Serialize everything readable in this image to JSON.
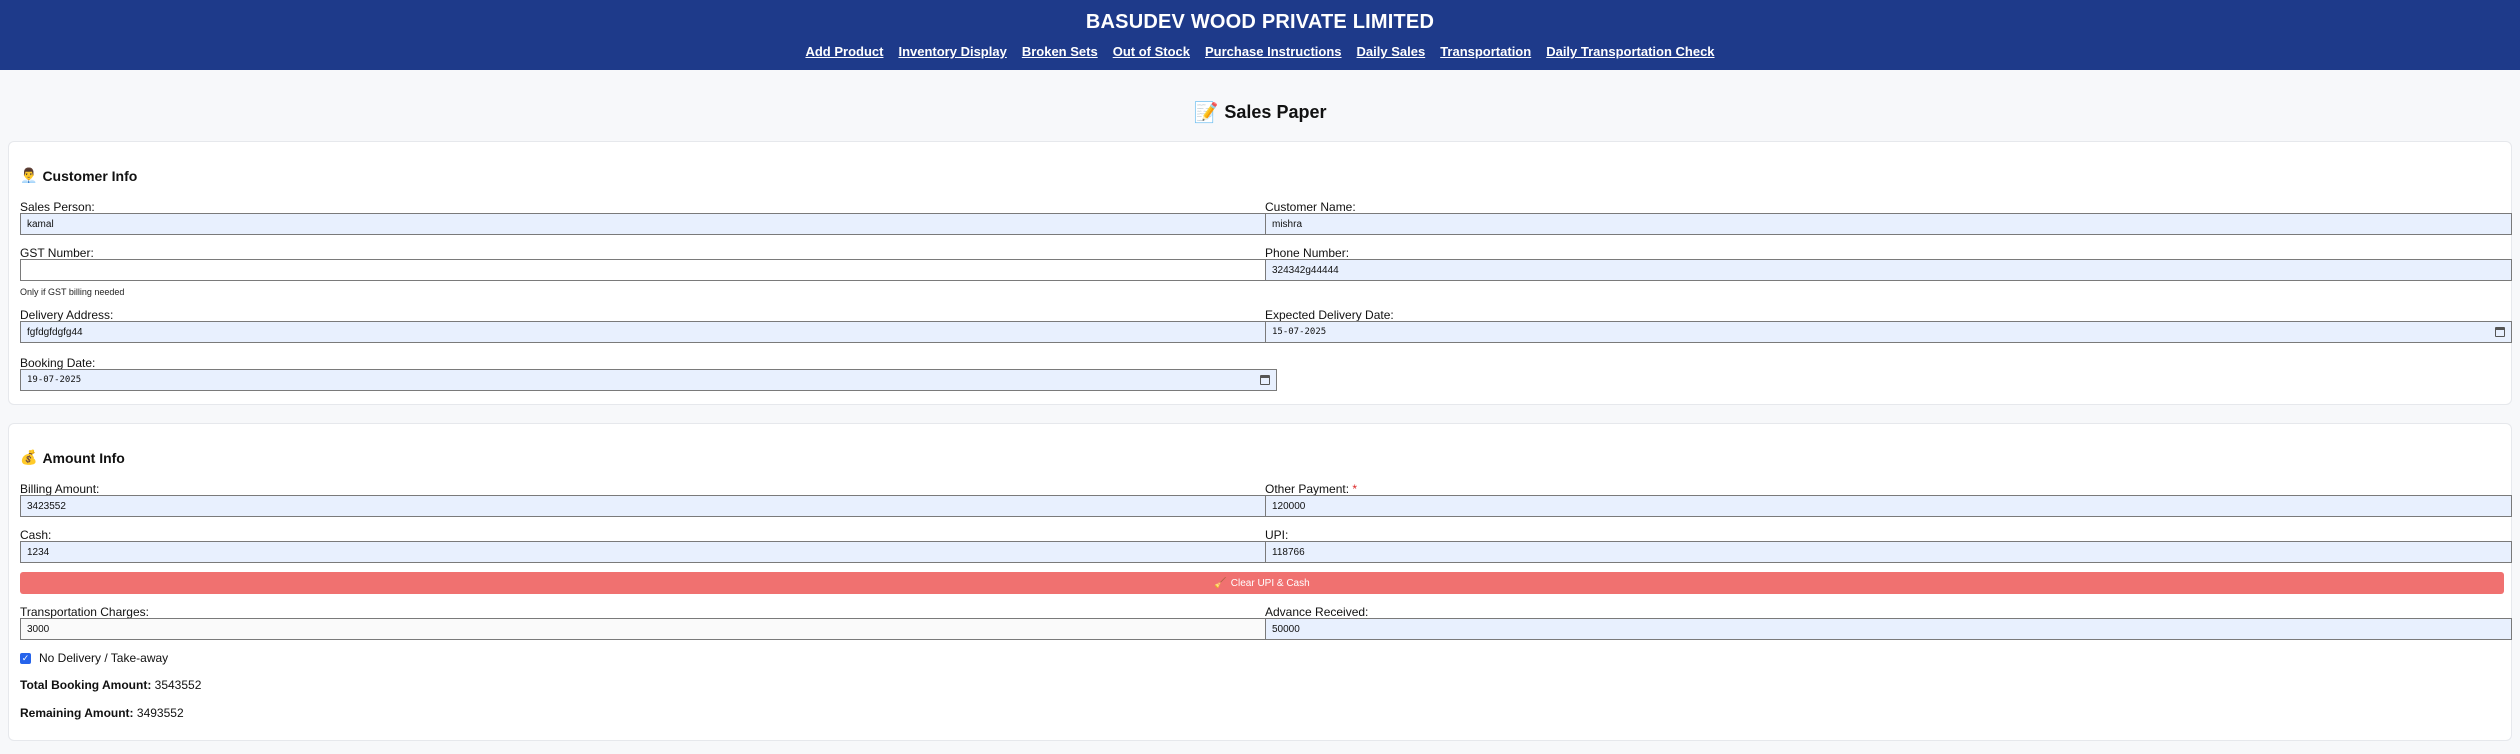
{
  "header": {
    "title": "BASUDEV WOOD PRIVATE LIMITED",
    "nav": [
      "Add Product",
      "Inventory Display",
      "Broken Sets",
      "Out of Stock",
      "Purchase Instructions",
      "Daily Sales",
      "Transportation",
      "Daily Transportation Check"
    ]
  },
  "page": {
    "icon": "📝",
    "title": "Sales Paper"
  },
  "customer": {
    "icon": "👨‍💼",
    "heading": "Customer Info",
    "sales_person": {
      "label": "Sales Person:",
      "value": "kamal"
    },
    "customer_name": {
      "label": "Customer Name:",
      "value": "mishra"
    },
    "gst": {
      "label": "GST Number:",
      "value": "",
      "hint": "Only if GST billing needed"
    },
    "phone": {
      "label": "Phone Number:",
      "value": "324342g44444"
    },
    "delivery_address": {
      "label": "Delivery Address:",
      "value": "fgfdgfdgfg44"
    },
    "expected_date": {
      "label": "Expected Delivery Date:",
      "value": "15-07-2025"
    },
    "booking_date": {
      "label": "Booking Date:",
      "value": "19-07-2025"
    }
  },
  "amount": {
    "icon": "💰",
    "heading": "Amount Info",
    "billing": {
      "label": "Billing Amount:",
      "value": "3423552"
    },
    "other_payment": {
      "label": "Other Payment:",
      "required": "*",
      "value": "120000"
    },
    "cash": {
      "label": "Cash:",
      "value": "1234"
    },
    "upi": {
      "label": "UPI:",
      "value": "118766"
    },
    "clear_button": {
      "icon": "🧹",
      "label": "Clear UPI & Cash"
    },
    "transport": {
      "label": "Transportation Charges:",
      "value": "3000"
    },
    "advance": {
      "label": "Advance Received:",
      "value": "50000"
    },
    "no_delivery": {
      "label": "No Delivery / Take-away",
      "checked": true
    },
    "total_booking": {
      "label": "Total Booking Amount:",
      "value": "3543552"
    },
    "remaining": {
      "label": "Remaining Amount:",
      "value": "3493552"
    }
  },
  "colors": {
    "header_bg": "#1e3a8a",
    "input_bg": "#e8f0fe",
    "clear_button_bg": "#f07170",
    "required": "#dc2626"
  }
}
